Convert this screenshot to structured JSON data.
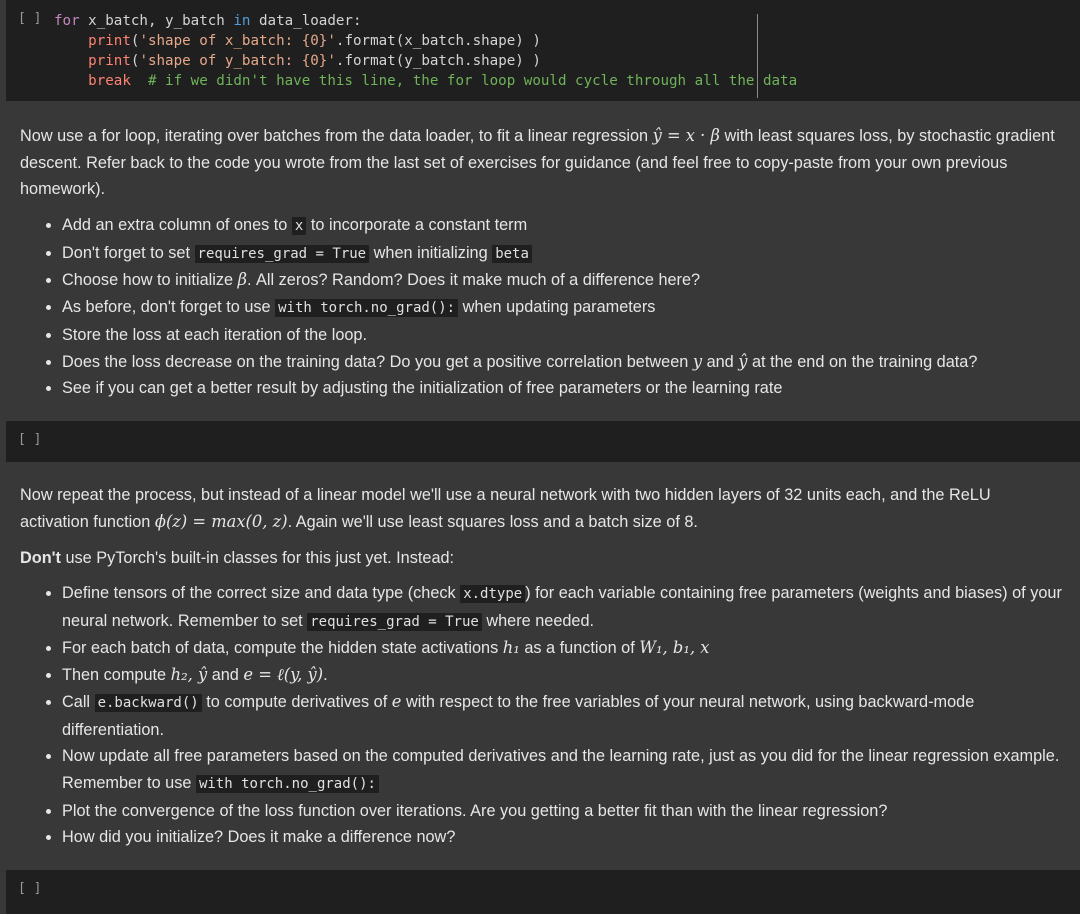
{
  "cell1": {
    "prompt": "[ ]",
    "code": {
      "line1": {
        "for": "for",
        "vars": " x_batch, y_batch ",
        "in": "in",
        "rest": " data_loader:"
      },
      "line2": {
        "indent": "    ",
        "fn": "print",
        "open": "(",
        "str": "'shape of x_batch: {0}'",
        "mid": ".format(x_batch.shape) )"
      },
      "line3": {
        "indent": "    ",
        "fn": "print",
        "open": "(",
        "str": "'shape of y_batch: {0}'",
        "mid": ".format(y_batch.shape) )"
      },
      "line4": {
        "indent": "    ",
        "kw": "break",
        "comment": "  # if we didn't have this line, the for loop would cycle through all the data"
      }
    }
  },
  "text1": {
    "p1_a": "Now use a for loop, iterating over batches from the data loader, to fit a linear regression ",
    "p1_math": "ŷ = x · β",
    "p1_b": " with least squares loss, by stochastic gradient descent. Refer back to the code you wrote from the last set of exercises for guidance (and feel free to copy-paste from your own previous homework).",
    "b1_a": "Add an extra column of ones to ",
    "b1_code": "x",
    "b1_b": " to incorporate a constant term",
    "b2_a": "Don't forget to set ",
    "b2_code": "requires_grad = True",
    "b2_b": " when initializing ",
    "b2_code2": "beta",
    "b3_a": "Choose how to initialize ",
    "b3_math": "β",
    "b3_b": ". All zeros? Random? Does it make much of a difference here?",
    "b4_a": "As before, don't forget to use ",
    "b4_code": "with torch.no_grad():",
    "b4_b": " when updating parameters",
    "b5": "Store the loss at each iteration of the loop.",
    "b6_a": "Does the loss decrease on the training data? Do you get a positive correlation between ",
    "b6_m1": "y",
    "b6_b": " and ",
    "b6_m2": "ŷ",
    "b6_c": " at the end on the training data?",
    "b7": "See if you can get a better result by adjusting the initialization of free parameters or the learning rate"
  },
  "cell2": {
    "prompt": "[ ]"
  },
  "text2": {
    "p1_a": "Now repeat the process, but instead of a linear model we'll use a neural network with two hidden layers of 32 units each, and the ReLU activation function ",
    "p1_math": "ϕ(z) = max(0, z)",
    "p1_b": ". Again we'll use least squares loss and a batch size of 8.",
    "p2_bold": "Don't",
    "p2_rest": " use PyTorch's built-in classes for this just yet. Instead:",
    "b1_a": "Define tensors of the correct size and data type (check ",
    "b1_code": "x.dtype",
    "b1_b": ") for each variable containing free parameters (weights and biases) of your neural network. Remember to set ",
    "b1_code2": "requires_grad = True",
    "b1_c": " where needed.",
    "b2_a": "For each batch of data, compute the hidden state activations ",
    "b2_m1": "h₁",
    "b2_b": " as a function of ",
    "b2_m2": "W₁, b₁, x",
    "b3_a": "Then compute ",
    "b3_m1": "h₂, ŷ",
    "b3_b": " and ",
    "b3_m2": "e = ℓ(y, ŷ)",
    "b3_c": ".",
    "b4_a": "Call ",
    "b4_code": "e.backward()",
    "b4_b": " to compute derivatives of ",
    "b4_m": "e",
    "b4_c": " with respect to the free variables of your neural network, using backward-mode differentiation.",
    "b5_a": "Now update all free parameters based on the computed derivatives and the learning rate, just as you did for the linear regression example. Remember to use ",
    "b5_code": "with torch.no_grad():",
    "b6": "Plot the convergence of the loss function over iterations. Are you getting a better fit than with the linear regression?",
    "b7": "How did you initialize? Does it make a difference now?"
  },
  "cell3": {
    "prompt": "[ ]"
  }
}
